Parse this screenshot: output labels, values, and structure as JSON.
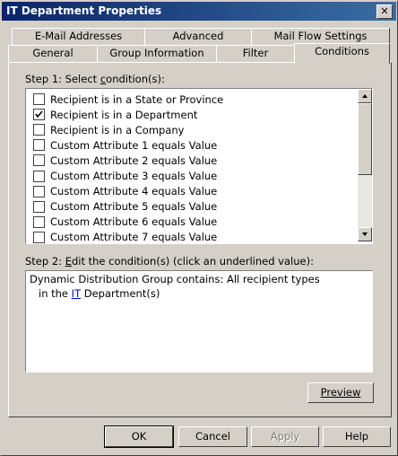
{
  "window": {
    "title": "IT Department Properties"
  },
  "tabs_back": [
    "E-Mail Addresses",
    "Advanced",
    "Mail Flow Settings"
  ],
  "tabs_front": [
    "General",
    "Group Information",
    "Filter",
    "Conditions"
  ],
  "step1": {
    "label_pre": "Step 1: Select ",
    "label_u": "c",
    "label_post": "ondition(s):"
  },
  "conditions": [
    {
      "label": "Recipient is in a State or Province",
      "checked": false
    },
    {
      "label": "Recipient is in a Department",
      "checked": true
    },
    {
      "label": "Recipient is in a Company",
      "checked": false
    },
    {
      "label": "Custom Attribute 1 equals Value",
      "checked": false
    },
    {
      "label": "Custom Attribute 2 equals Value",
      "checked": false
    },
    {
      "label": "Custom Attribute 3 equals Value",
      "checked": false
    },
    {
      "label": "Custom Attribute 4 equals Value",
      "checked": false
    },
    {
      "label": "Custom Attribute 5 equals Value",
      "checked": false
    },
    {
      "label": "Custom Attribute 6 equals Value",
      "checked": false
    },
    {
      "label": "Custom Attribute 7 equals Value",
      "checked": false
    }
  ],
  "step2": {
    "label_pre": "Step 2: ",
    "label_u": "E",
    "label_post": "dit the condition(s) (click an underlined value):"
  },
  "edit": {
    "line1": "Dynamic Distribution Group contains: All recipient types",
    "line2_pre": "in the",
    "line2_link": "IT",
    "line2_post": "Department(s)"
  },
  "buttons": {
    "preview": "Preview",
    "ok": "OK",
    "cancel": "Cancel",
    "apply": "Apply",
    "help": "Help"
  }
}
